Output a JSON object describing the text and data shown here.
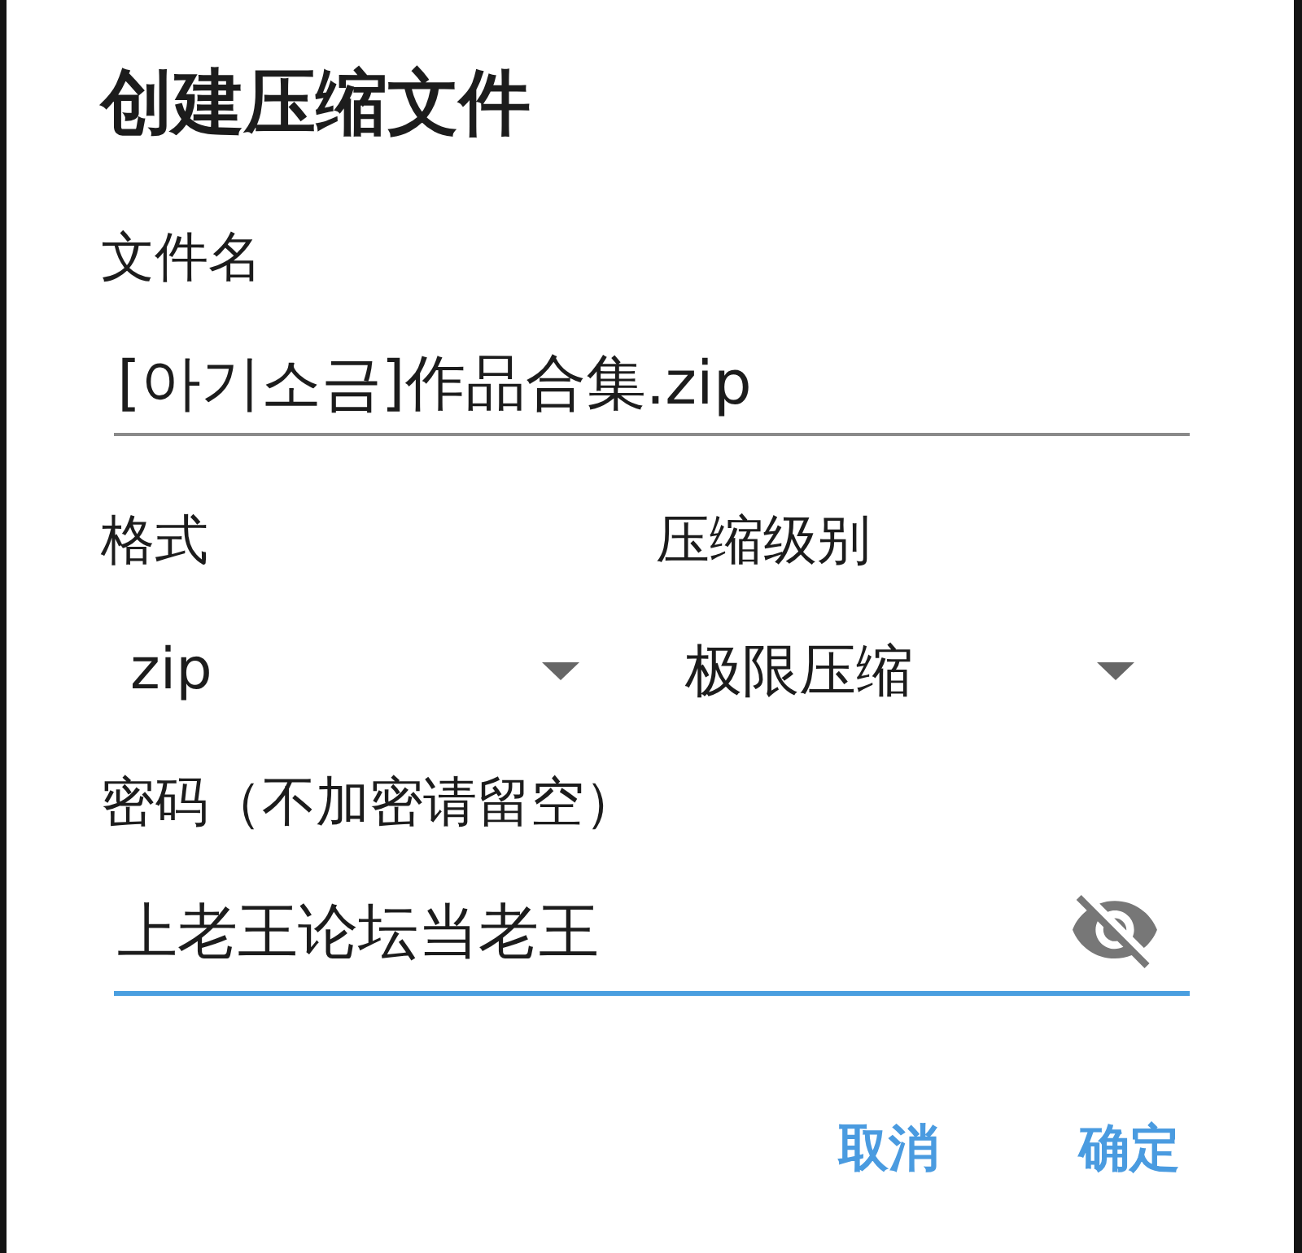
{
  "dialog": {
    "title": "创建压缩文件"
  },
  "filename": {
    "label": "文件名",
    "value": "[아기소금]作品合集.zip",
    "focused": false
  },
  "selects": [
    {
      "label": "格式",
      "value": "zip"
    },
    {
      "label": "压缩级别",
      "value": "极限压缩"
    }
  ],
  "password": {
    "label": "密码（不加密请留空）",
    "value": "上老王论坛当老王",
    "focused": true,
    "show_password": true
  },
  "buttons": [
    {
      "label": "取消"
    },
    {
      "label": "确定"
    }
  ]
}
